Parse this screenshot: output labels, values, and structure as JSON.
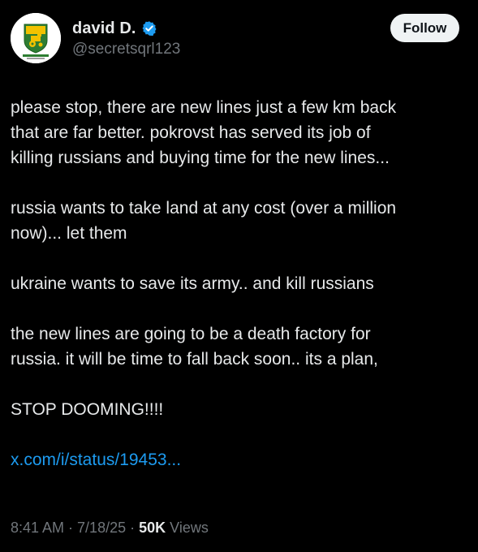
{
  "author": {
    "display_name": "david D.",
    "handle": "@secretsqrl123",
    "verified": true
  },
  "follow_button": {
    "label": "Follow"
  },
  "tweet": {
    "paragraphs": [
      [
        "please stop, there are new lines just a few km back",
        "that are far better. pokrovst has served its job of",
        "killing russians and buying time for the new lines..."
      ],
      [
        "russia wants to take land at any cost (over a million",
        "now)... let them"
      ],
      [
        "ukraine wants to save its army.. and kill russians"
      ],
      [
        "the new lines are going to be a death factory for",
        "russia. it will be time to fall back soon.. its a plan,"
      ],
      [
        "STOP DOOMING!!!!"
      ]
    ],
    "link_text": "x.com/i/status/19453..."
  },
  "meta": {
    "time": "8:41 AM",
    "sep1": " · ",
    "date": "7/18/25",
    "sep2": " · ",
    "views_count": "50K",
    "views_label": " Views"
  },
  "colors": {
    "background": "#000000",
    "text": "#e7e9ea",
    "muted": "#71767b",
    "link": "#1d9bf0",
    "verified_badge": "#1d9bf0",
    "follow_bg": "#eff3f4",
    "avatar_green": "#2e7d32",
    "avatar_yellow": "#f2c200"
  },
  "icons": {
    "avatar": "tractor-emblem-icon",
    "verified": "verified-badge-icon"
  }
}
